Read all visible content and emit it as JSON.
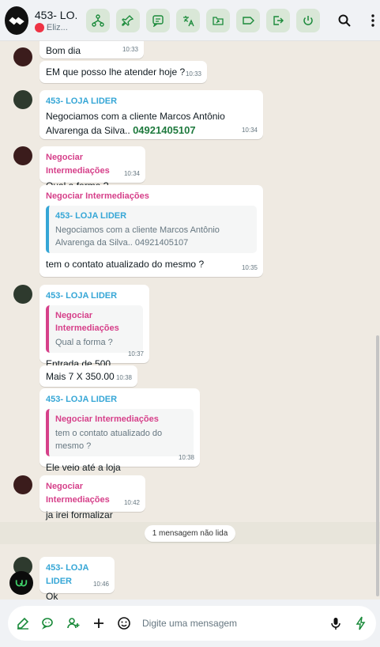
{
  "header": {
    "title": "453- LO.",
    "subtitle": "Eliz...",
    "toolbar_icons": [
      "share-tree-icon",
      "pin-icon",
      "chat-note-icon",
      "translate-icon",
      "folder-share-icon",
      "label-icon",
      "exit-arrow-icon",
      "power-icon"
    ],
    "right_icons": [
      "search-icon",
      "kebab-menu-icon"
    ]
  },
  "messages": [
    {
      "text": "Bom dia",
      "time": "10:33"
    },
    {
      "text": "EM que posso lhe atender hoje ?",
      "time": "10:33"
    },
    {
      "sender": "453- LOJA LIDER",
      "text": "Negociamos com a cliente Marcos  Antônio",
      "text2": "Alvarenga da Silva..",
      "phone": "04921405107",
      "time": "10:34"
    },
    {
      "sender": "Negociar Intermediações",
      "text": "Qual a forma ?",
      "time": "10:34"
    },
    {
      "sender": "Negociar Intermediações",
      "quote_sender": "453- LOJA LIDER",
      "quote_text": "Negociamos com a cliente Marcos  Antônio Alvarenga da Silva.. 04921405107",
      "text": "tem o contato atualizado do mesmo ?",
      "time": "10:35"
    },
    {
      "sender": "453- LOJA LIDER",
      "quote_sender": "Negociar Intermediações",
      "quote_text": "Qual a forma ?",
      "text": "Entrada de 500",
      "time": "10:37"
    },
    {
      "text": "Mais 7 X 350.00",
      "time": "10:38"
    },
    {
      "sender": "453- LOJA LIDER",
      "quote_sender": "Negociar Intermediações",
      "quote_text": "tem o contato atualizado do mesmo ?",
      "text": "Ele veio até a loja",
      "time": "10:38"
    },
    {
      "sender": "Negociar Intermediações",
      "text": "ja irei formalizar",
      "time": "10:42"
    },
    {
      "sender": "453- LOJA LIDER",
      "text": "Ok",
      "time": "10:46"
    }
  ],
  "unread_label": "1 mensagem não lida",
  "composer": {
    "placeholder": "Digite uma mensagem",
    "icons": [
      "edit-icon",
      "chat-bubbles-icon",
      "user-plus-icon",
      "plus-icon",
      "sticker-icon",
      "mic-icon",
      "bolt-icon"
    ]
  },
  "colors": {
    "accent_green": "#1a8a3a",
    "sender_blue": "#35a6d6",
    "sender_pink": "#d6408a",
    "chat_bg": "#efeae2"
  }
}
